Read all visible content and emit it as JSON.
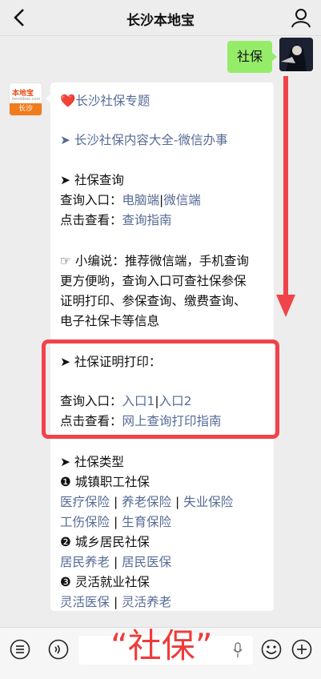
{
  "header": {
    "title": "长沙本地宝"
  },
  "chat": {
    "user_message": "社保",
    "sender_logo": "本地宝",
    "sender_logo_sub": "bendibao.com",
    "sender_city": "长沙",
    "lines": {
      "title": "长沙社保专题",
      "l1": "➤ 长沙社保内容大全-微信办事",
      "l2": "➤ 社保查询",
      "l3_label": "查询入口：",
      "l3_link1": "电脑端",
      "l3_sep": "|",
      "l3_link2": "微信端",
      "l4_label": "点击查看：",
      "l4_link": "查询指南",
      "l5": "☞ 小编说：推荐微信端，手机查询",
      "l6": "更方便哟，查询入口可查社保参保",
      "l7": "证明打印、参保查询、缴费查询、",
      "l8": "电子社保卡等信息",
      "l9": "➤ 社保证明打印：",
      "l10_label": "查询入口：",
      "l10_link1": "入口1",
      "l10_sep": "|",
      "l10_link2": "入口2",
      "l11_label": "点击查看：",
      "l11_link": "网上查询打印指南",
      "l12": "➤ 社保类型",
      "l13": "❶ 城镇职工社保",
      "l14_a": "医疗保险",
      "l14_b": "养老保险",
      "l14_c": "失业保险",
      "l15_a": "工伤保险",
      "l15_b": "生育保险",
      "l16": "❷ 城乡居民社保",
      "l17_a": "居民养老",
      "l17_b": "居民医保",
      "l18": "❸ 灵活就业社保",
      "l19_a": "灵活医保",
      "l19_b": "灵活养老",
      "sep": " | "
    }
  },
  "overlay_text": "“社保”",
  "colors": {
    "link": "#576b95",
    "accent_red": "#f0434a",
    "bubble_green": "#95ec69"
  }
}
